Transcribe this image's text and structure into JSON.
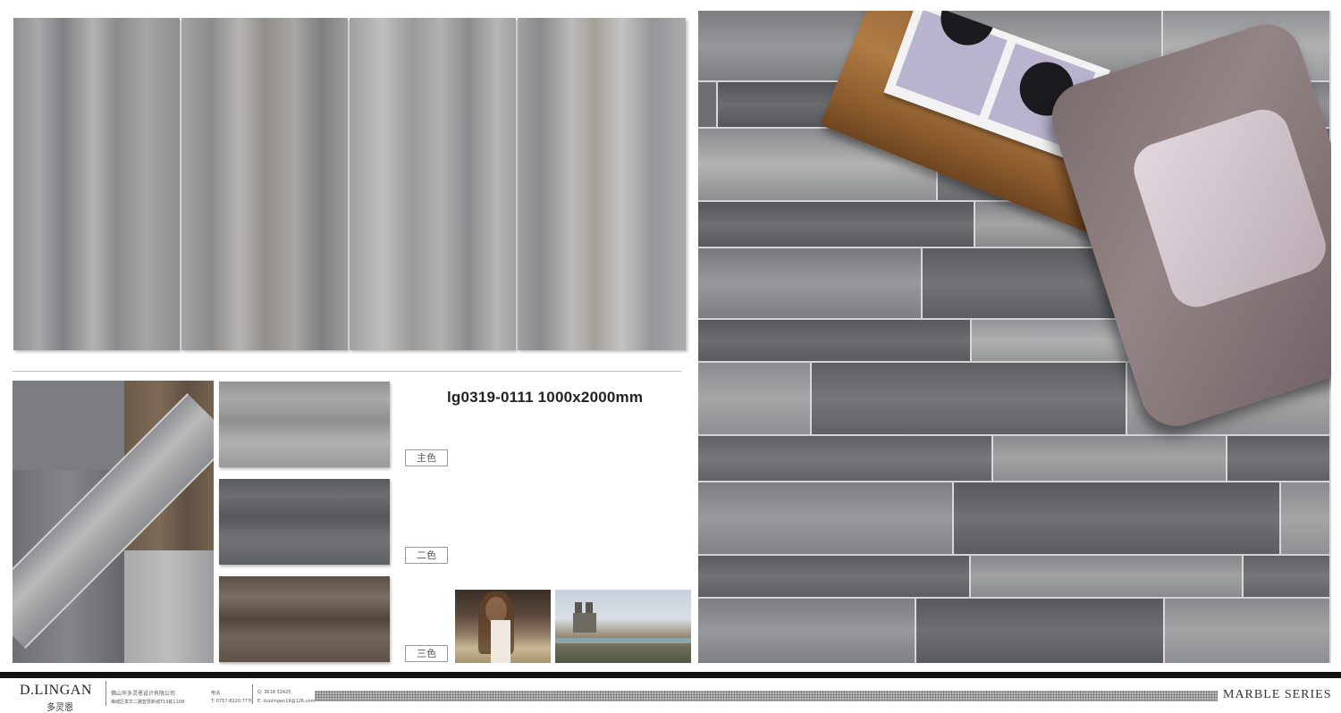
{
  "product": {
    "model_code": "lg0319-0111  1000x2000mm"
  },
  "color_tags": [
    {
      "label": "主色"
    },
    {
      "label": "二色"
    },
    {
      "label": "三色"
    }
  ],
  "footer": {
    "brand": "D.LINGAN",
    "brand_cn": "多灵恩",
    "company": "佛山市多灵恩设计有限公司",
    "address": "禅城区季华二路智慧新城T13栋1108",
    "phone_label": "电话",
    "phone": "T: 0757-8220 7770",
    "qq": "Q: 3618 32425",
    "email": "E: duolingen19@126.com",
    "series": "MARBLE  SERIES"
  },
  "colors": {
    "footer_bar": "#111111",
    "accent_text": "#222222"
  }
}
